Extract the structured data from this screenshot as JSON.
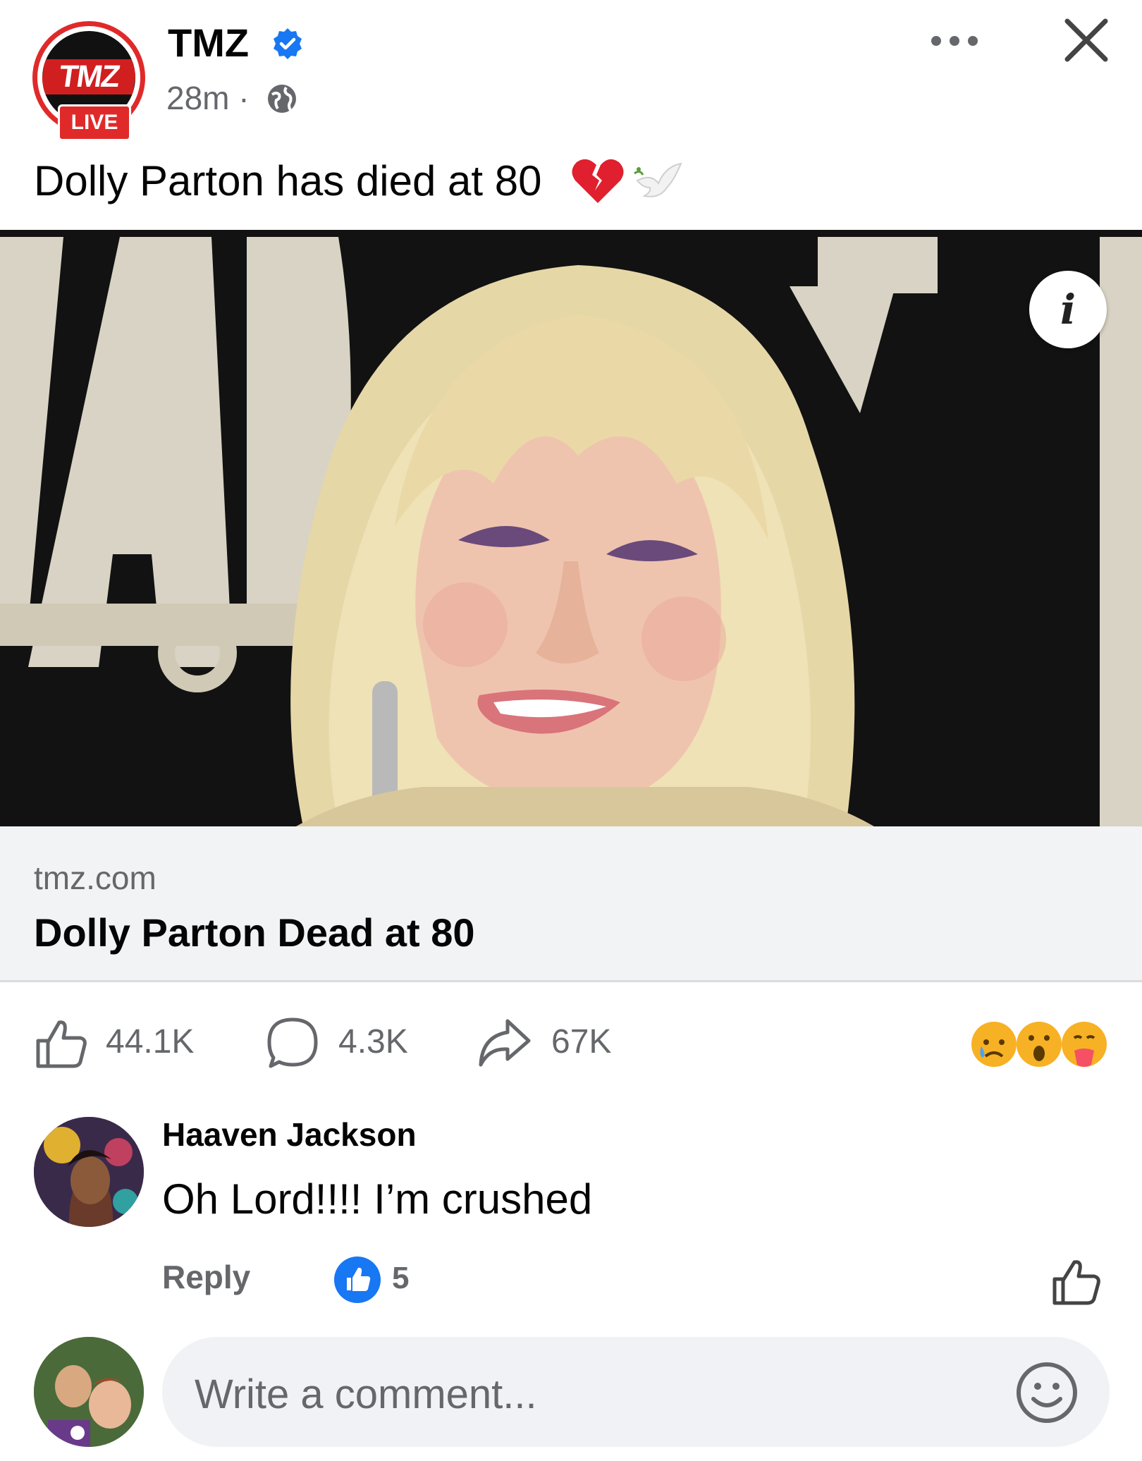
{
  "header": {
    "page_name": "TMZ",
    "time": "28m",
    "separator": "·",
    "live_label": "LIVE",
    "logo_text": "TMZ"
  },
  "post": {
    "text": "Dolly Parton has died at 80",
    "emojis": [
      "broken-heart-icon",
      "dove-icon"
    ]
  },
  "link_preview": {
    "domain": "tmz.com",
    "title": "Dolly Parton Dead at 80"
  },
  "actions": {
    "likes": "44.1K",
    "comments": "4.3K",
    "shares": "67K",
    "reactions": [
      "sad-face-icon",
      "wow-face-icon",
      "care-face-icon"
    ]
  },
  "comment": {
    "author": "Haaven Jackson",
    "text": "Oh Lord!!!! I’m crushed",
    "reply_label": "Reply",
    "like_count": "5"
  },
  "composer": {
    "placeholder": "Write a comment..."
  },
  "colors": {
    "accent": "#1877f2",
    "tmz_red": "#e02a2a",
    "muted_text": "#65676b",
    "link_bg": "#f2f3f5"
  }
}
